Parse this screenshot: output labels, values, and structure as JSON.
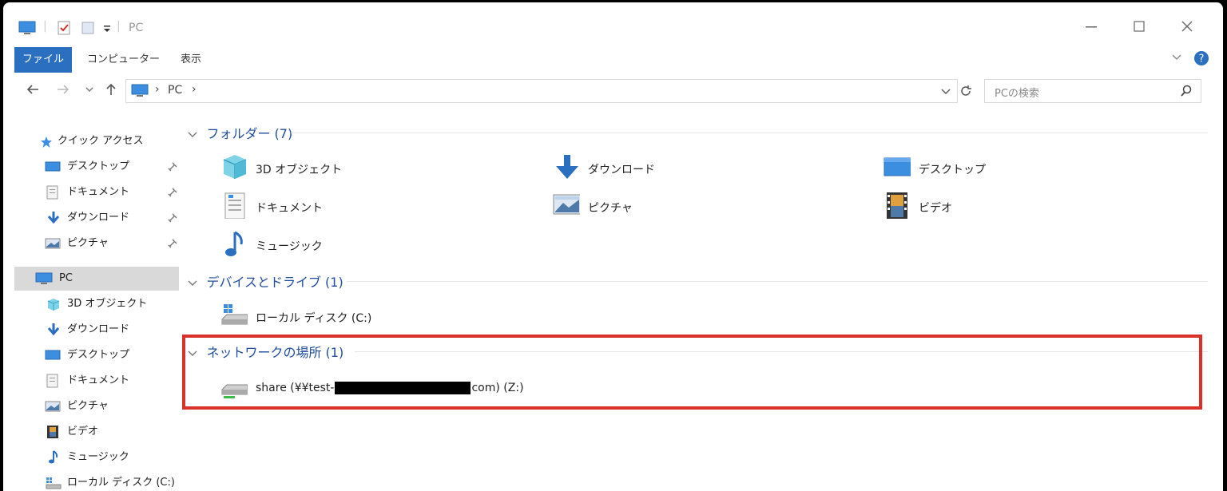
{
  "window": {
    "title": "PC"
  },
  "ribbon": {
    "tabs": [
      {
        "label": "ファイル"
      },
      {
        "label": "コンピューター"
      },
      {
        "label": "表示"
      }
    ]
  },
  "address": {
    "crumbs": [
      "PC"
    ]
  },
  "search": {
    "placeholder": "PCの検索"
  },
  "sidebar": {
    "quick_access": "クイック アクセス",
    "quick_items": [
      {
        "label": "デスクトップ",
        "icon": "desktop-icon"
      },
      {
        "label": "ドキュメント",
        "icon": "document-icon"
      },
      {
        "label": "ダウンロード",
        "icon": "download-icon"
      },
      {
        "label": "ピクチャ",
        "icon": "pictures-icon"
      }
    ],
    "pc": "PC",
    "pc_items": [
      {
        "label": "3D オブジェクト",
        "icon": "3d-objects-icon"
      },
      {
        "label": "ダウンロード",
        "icon": "download-icon"
      },
      {
        "label": "デスクトップ",
        "icon": "desktop-icon"
      },
      {
        "label": "ドキュメント",
        "icon": "document-icon"
      },
      {
        "label": "ピクチャ",
        "icon": "pictures-icon"
      },
      {
        "label": "ビデオ",
        "icon": "video-icon"
      },
      {
        "label": "ミュージック",
        "icon": "music-icon"
      },
      {
        "label": "ローカル ディスク (C:)",
        "icon": "local-disk-icon"
      }
    ]
  },
  "sections": {
    "folders": {
      "title": "フォルダー (7)",
      "items": [
        {
          "label": "3D オブジェクト",
          "icon": "3d-objects-icon"
        },
        {
          "label": "ダウンロード",
          "icon": "download-icon"
        },
        {
          "label": "デスクトップ",
          "icon": "desktop-icon"
        },
        {
          "label": "ドキュメント",
          "icon": "document-icon"
        },
        {
          "label": "ピクチャ",
          "icon": "pictures-icon"
        },
        {
          "label": "ビデオ",
          "icon": "video-icon"
        },
        {
          "label": "ミュージック",
          "icon": "music-icon"
        }
      ]
    },
    "devices": {
      "title": "デバイスとドライブ (1)",
      "items": [
        {
          "label": "ローカル ディスク (C:)",
          "icon": "local-disk-icon"
        }
      ]
    },
    "network": {
      "title": "ネットワークの場所 (1)",
      "items": [
        {
          "label_start": "share (¥¥test-",
          "label_end": "com) (Z:)",
          "icon": "network-drive-icon"
        }
      ]
    }
  },
  "colors": {
    "accent": "#2b6fc0",
    "section_title": "#1f4e9e",
    "highlight_box": "#d9302a",
    "selected_bg": "#d9d9d9"
  }
}
